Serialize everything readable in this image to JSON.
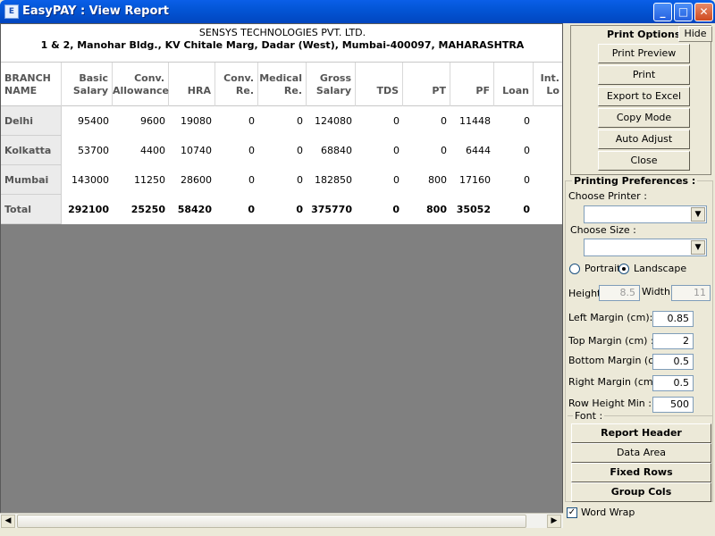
{
  "window": {
    "title": "EasyPAY : View Report",
    "min_glyph": "_",
    "max_glyph": "□",
    "close_glyph": "✕"
  },
  "report": {
    "company": "SENSYS TECHNOLOGIES PVT. LTD.",
    "address": "1 & 2, Manohar Bldg., KV Chitale Marg, Dadar (West), Mumbai-400097, MAHARASHTRA",
    "columns": [
      {
        "line1": "BRANCH",
        "line2": "NAME"
      },
      {
        "line1": "Basic",
        "line2": "Salary"
      },
      {
        "line1": "Conv.",
        "line2": "Allowance"
      },
      {
        "line1": "",
        "line2": "HRA"
      },
      {
        "line1": "Conv.",
        "line2": "Re."
      },
      {
        "line1": "Medical",
        "line2": "Re."
      },
      {
        "line1": "Gross",
        "line2": "Salary"
      },
      {
        "line1": "",
        "line2": "TDS"
      },
      {
        "line1": "",
        "line2": "PT"
      },
      {
        "line1": "",
        "line2": "PF"
      },
      {
        "line1": "",
        "line2": "Loan"
      },
      {
        "line1": "Int.",
        "line2": "Lo"
      }
    ],
    "rows": [
      {
        "name": "Delhi",
        "values": [
          "95400",
          "9600",
          "19080",
          "0",
          "0",
          "124080",
          "0",
          "0",
          "11448",
          "0"
        ]
      },
      {
        "name": "Kolkatta",
        "values": [
          "53700",
          "4400",
          "10740",
          "0",
          "0",
          "68840",
          "0",
          "0",
          "6444",
          "0"
        ]
      },
      {
        "name": "Mumbai",
        "values": [
          "143000",
          "11250",
          "28600",
          "0",
          "0",
          "182850",
          "0",
          "800",
          "17160",
          "0"
        ]
      }
    ],
    "total": {
      "name": "Total",
      "values": [
        "292100",
        "25250",
        "58420",
        "0",
        "0",
        "375770",
        "0",
        "800",
        "35052",
        "0"
      ]
    }
  },
  "print_options": {
    "title": "Print Options",
    "hide_label": "Hide",
    "buttons": [
      "Print Preview",
      "Print",
      "Export to Excel",
      "Copy Mode",
      "Auto Adjust",
      "Close"
    ]
  },
  "preferences": {
    "title": "Printing Preferences :",
    "choose_printer_label": "Choose Printer :",
    "choose_printer_value": "",
    "choose_size_label": "Choose Size :",
    "choose_size_value": "",
    "portrait_label": "Portrait",
    "landscape_label": "Landscape",
    "orientation": "Landscape",
    "height_label": "Height",
    "height_value": "8.5",
    "width_label": "Width",
    "width_value": "11",
    "left_margin_label": "Left Margin (cm):",
    "left_margin_value": "0.85",
    "top_margin_label": "Top Margin (cm) :",
    "top_margin_value": "2",
    "bottom_margin_label": "Bottom Margin (cm)",
    "bottom_margin_value": "0.5",
    "right_margin_label": "Right Margin (cm) :",
    "right_margin_value": "0.5",
    "row_height_label": "Row Height Min :",
    "row_height_value": "500",
    "font_label": "Font :",
    "font_buttons": [
      "Report Header",
      "Data Area",
      "Fixed Rows",
      "Group Cols"
    ],
    "word_wrap_label": "Word Wrap",
    "word_wrap_checked": true
  },
  "icons": {
    "app": "easypay-app-icon",
    "scroll_left": "◀",
    "scroll_right": "▶",
    "dropdown": "▼",
    "check": "✓"
  }
}
